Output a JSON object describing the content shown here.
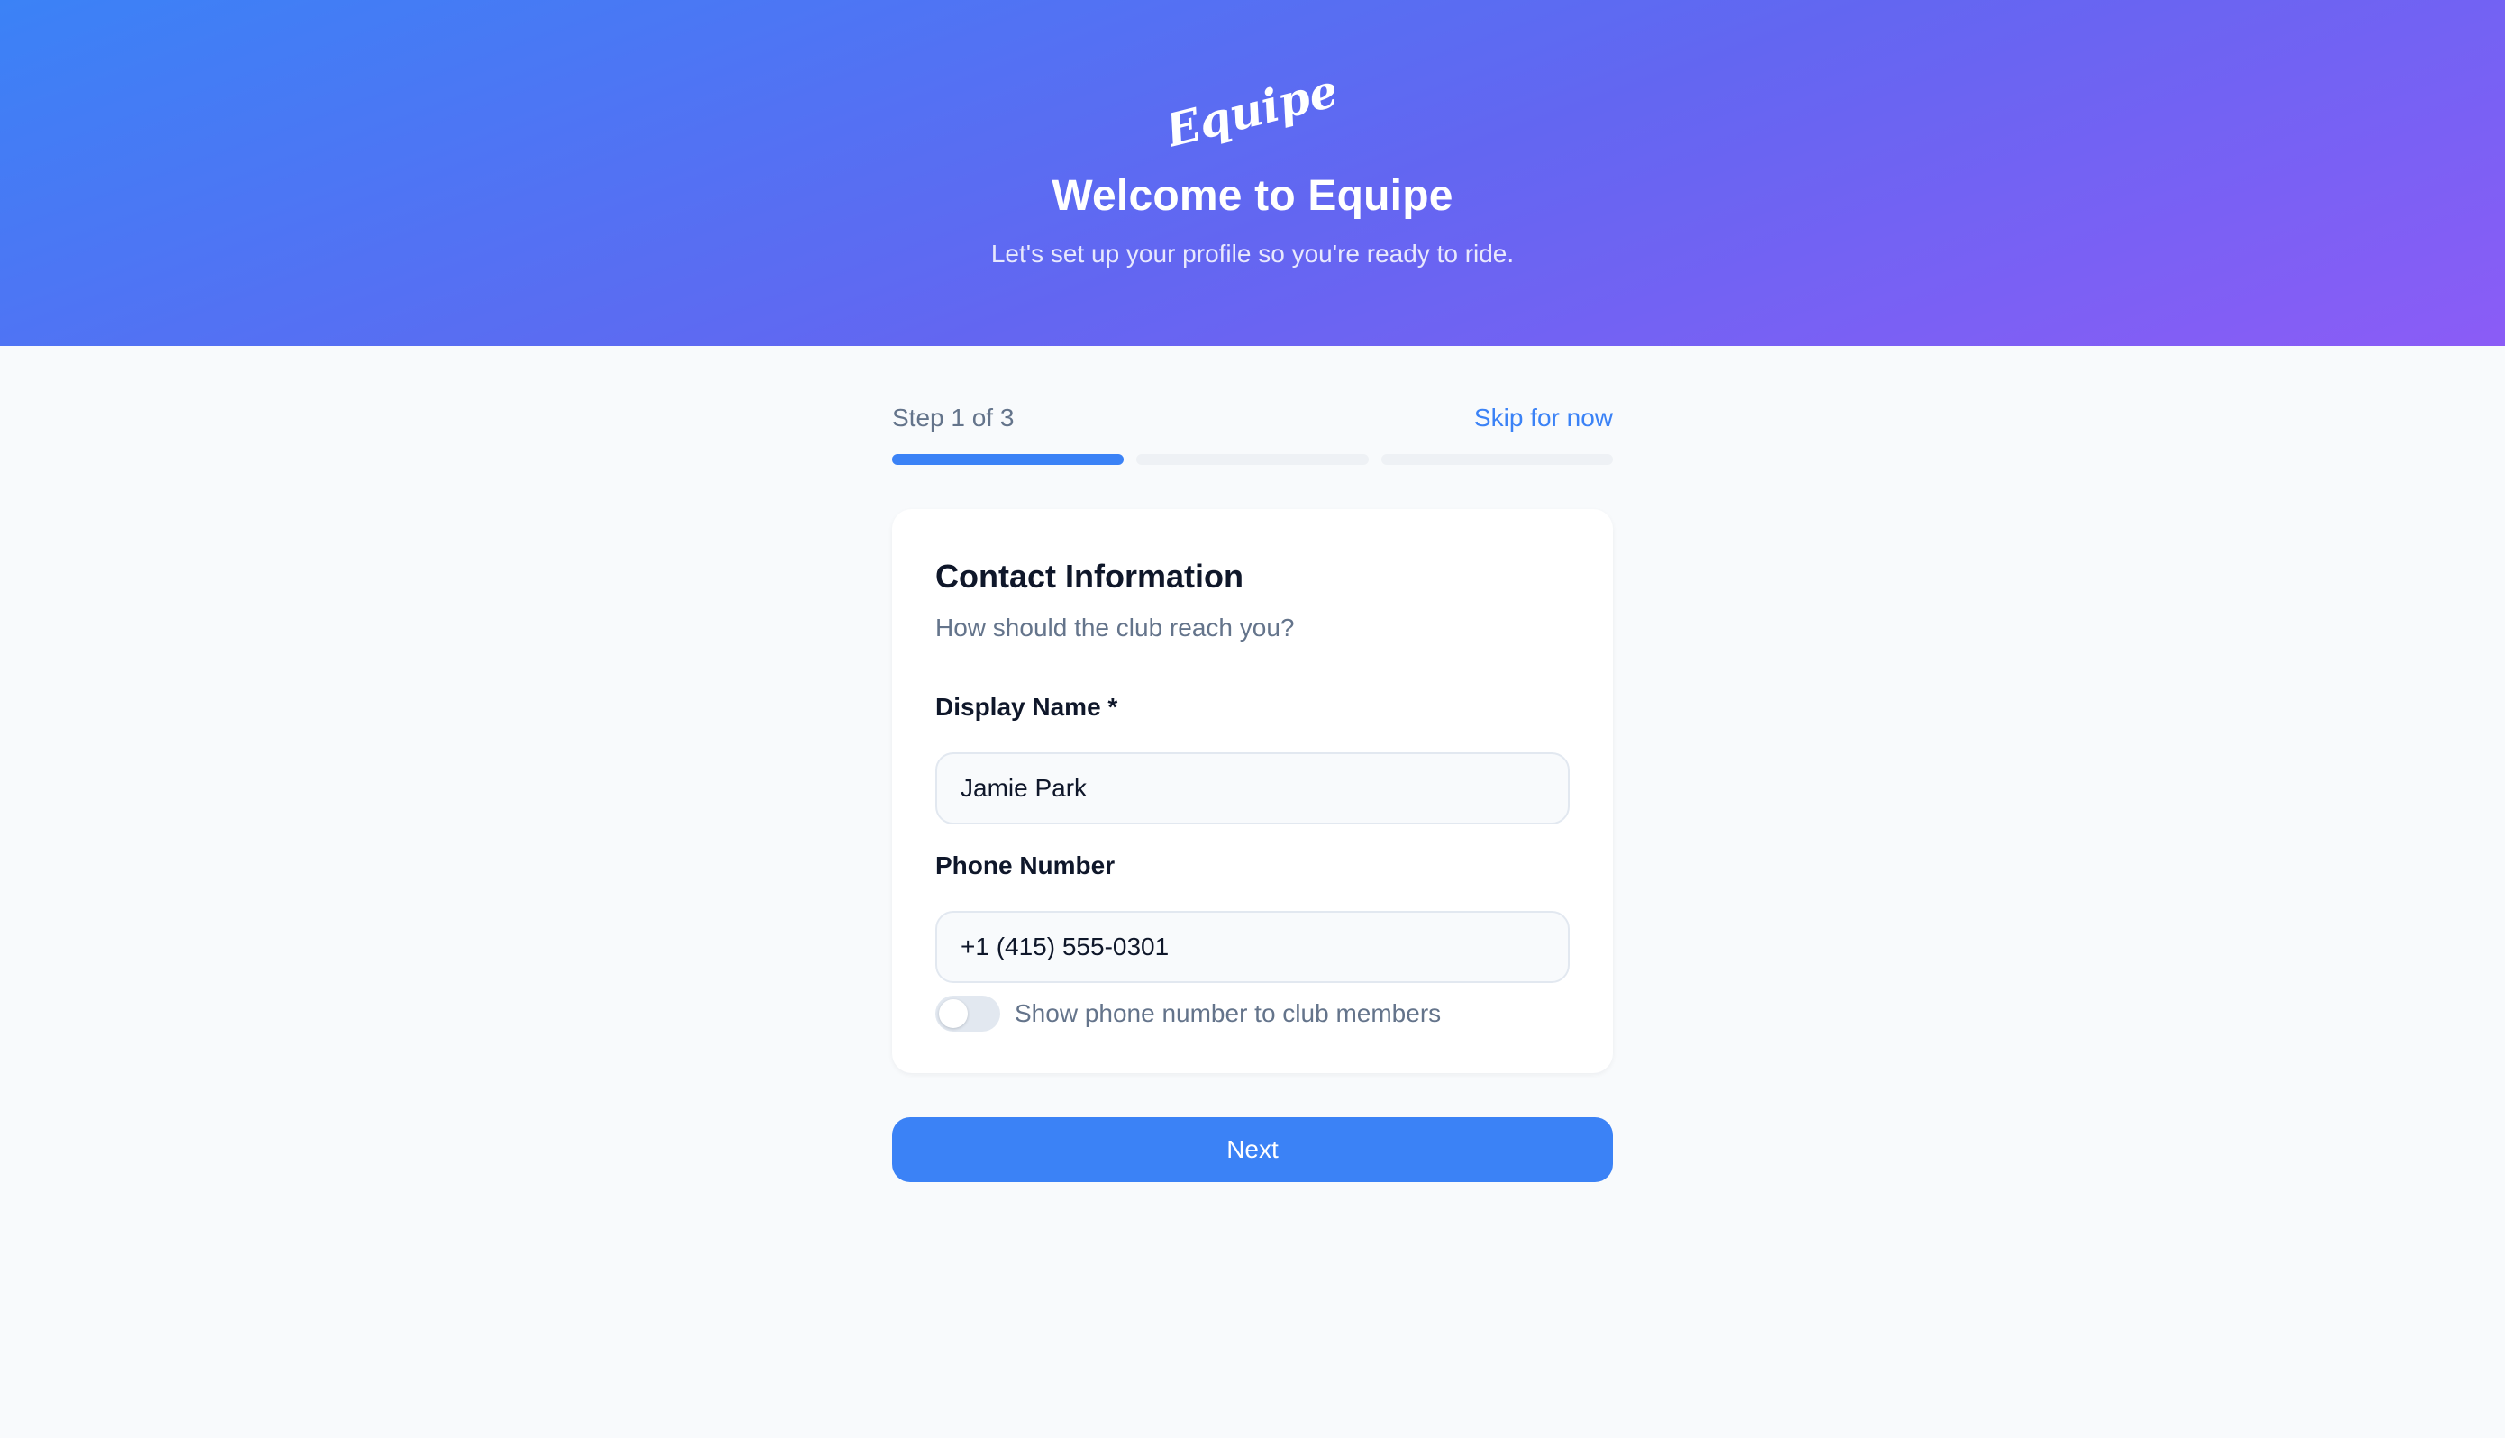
{
  "colors": {
    "accent": "#3b82f6",
    "banner_gradient": [
      "#3b82f6",
      "#6366f1",
      "#8b5cf6"
    ],
    "background": "#f8fafc",
    "text_primary": "#0f172a",
    "text_muted": "#64748b"
  },
  "header": {
    "logo_text": "Equipe",
    "title": "Welcome to Equipe",
    "subtitle": "Let's set up your profile so you're ready to ride."
  },
  "steps": {
    "label": "Step 1 of 3",
    "skip_label": "Skip for now",
    "current": 1,
    "total": 3
  },
  "card": {
    "title": "Contact Information",
    "subtitle": "How should the club reach you?",
    "fields": {
      "display_name": {
        "label": "Display Name *",
        "value": "Jamie Park"
      },
      "phone": {
        "label": "Phone Number",
        "value": "+1 (415) 555-0301"
      }
    },
    "toggle": {
      "label": "Show phone number to club members",
      "checked": false
    }
  },
  "actions": {
    "next_label": "Next"
  }
}
